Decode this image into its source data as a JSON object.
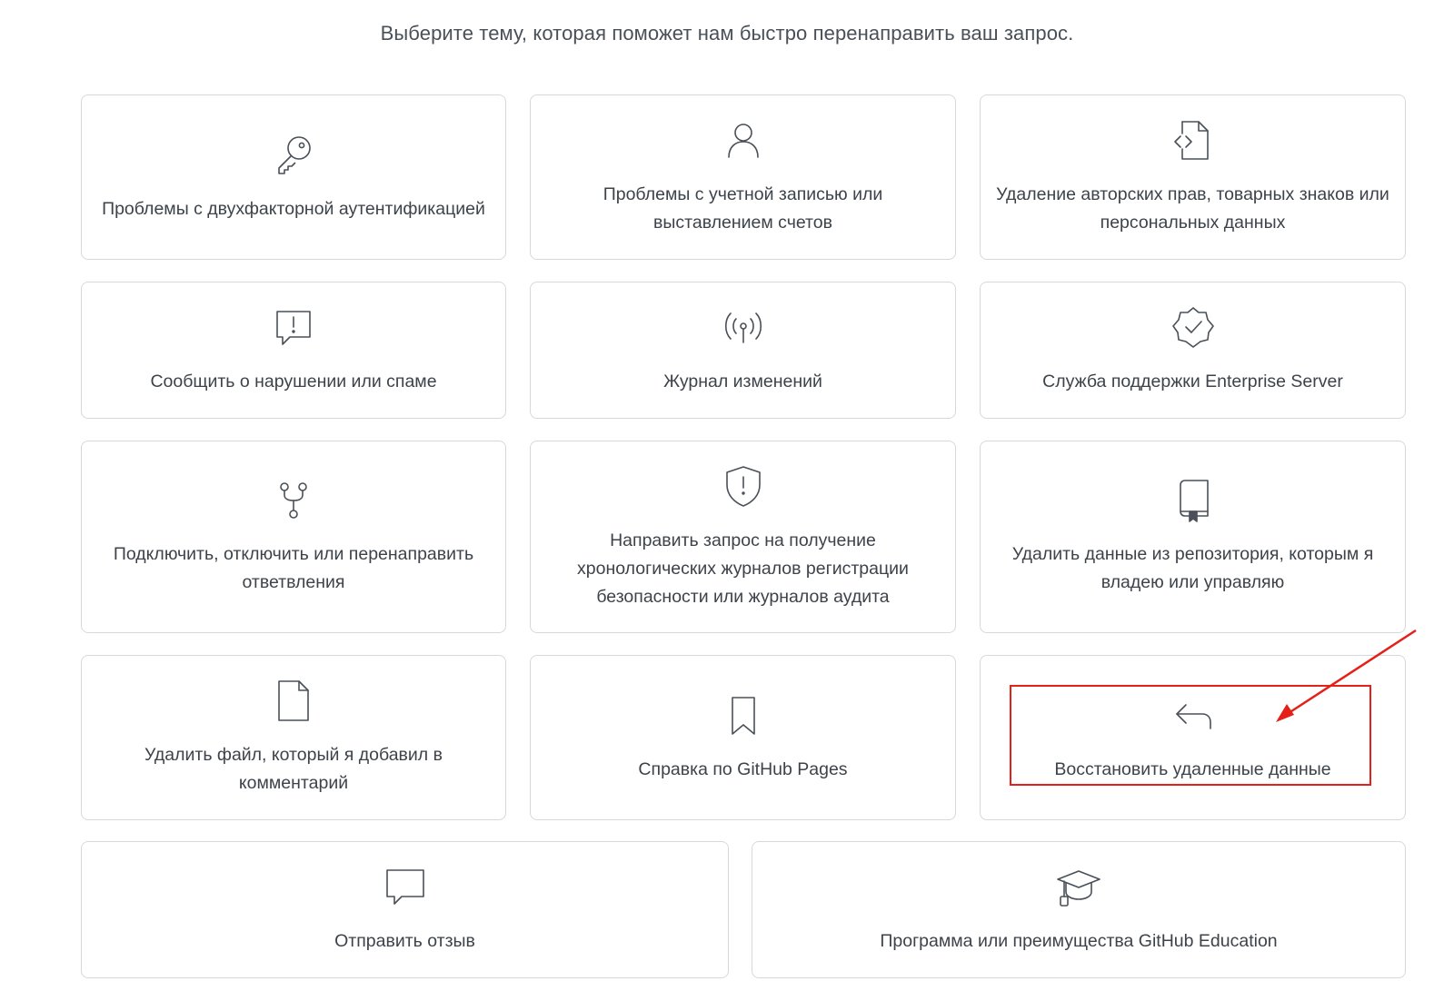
{
  "intro_text": "Выберите тему, которая поможет нам быстро перенаправить ваш запрос.",
  "annotation_color": "#e42118",
  "cards": [
    {
      "icon": "key-icon",
      "label": "Проблемы с двухфакторной аутентификацией"
    },
    {
      "icon": "person-icon",
      "label": "Проблемы с учетной записью или выставлением счетов"
    },
    {
      "icon": "file-code-icon",
      "label": "Удаление авторских прав, товарных знаков или персональных данных"
    },
    {
      "icon": "report-icon",
      "label": "Сообщить о нарушении или спаме"
    },
    {
      "icon": "broadcast-icon",
      "label": "Журнал изменений"
    },
    {
      "icon": "verified-icon",
      "label": "Служба поддержки Enterprise Server"
    },
    {
      "icon": "repo-forked-icon",
      "label": "Подключить, отключить или перенаправить ответвления"
    },
    {
      "icon": "shield-icon",
      "label": "Направить запрос на получение хронологических журналов регистрации безопасности или журналов аудита"
    },
    {
      "icon": "repo-icon",
      "label": "Удалить данные из репозитория, которым я владею или управляю"
    },
    {
      "icon": "file-icon",
      "label": "Удалить файл, который я добавил в комментарий"
    },
    {
      "icon": "bookmark-icon",
      "label": "Справка по GitHub Pages"
    },
    {
      "icon": "reply-icon",
      "label": "Восстановить удаленные данные"
    },
    {
      "icon": "comment-icon",
      "label": "Отправить отзыв"
    },
    {
      "icon": "mortar-board-icon",
      "label": "Программа или преимущества GitHub Education"
    }
  ]
}
